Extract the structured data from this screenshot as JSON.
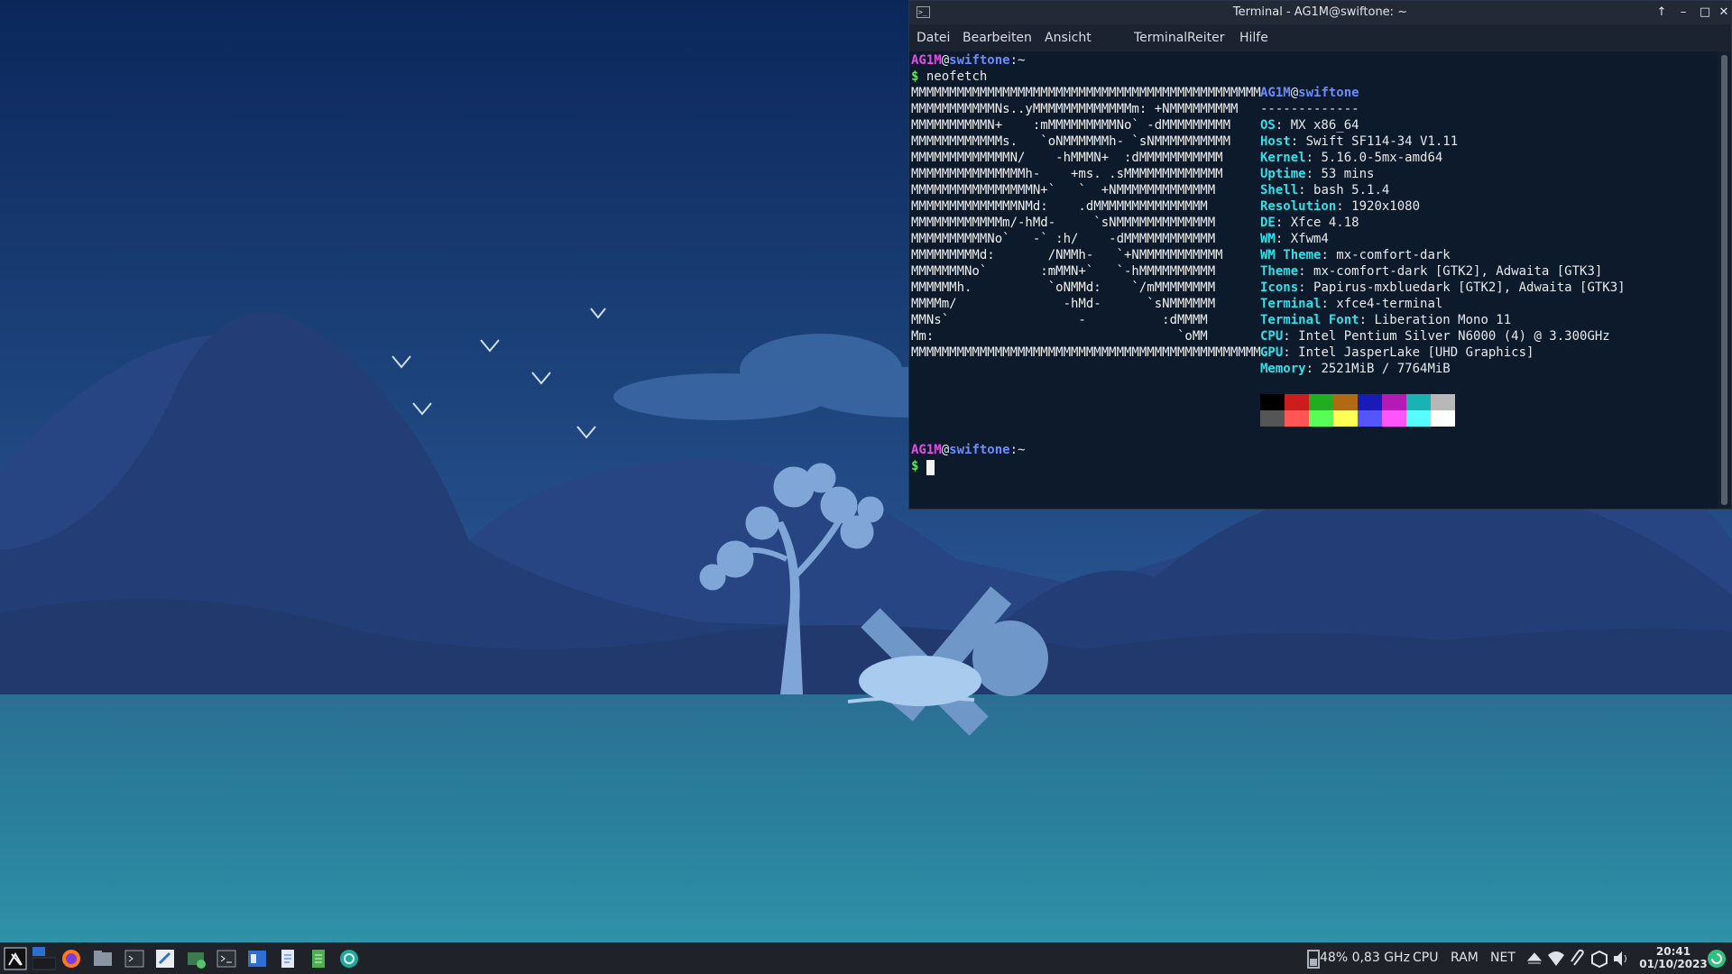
{
  "terminal": {
    "title": "Terminal - AG1M@swiftone: ~",
    "menu": [
      "Datei",
      "Bearbeiten",
      "Ansicht",
      "Terminal",
      "Reiter",
      "Hilfe"
    ],
    "prompt_user": "AG1M",
    "prompt_at": "@",
    "prompt_host": "swiftone",
    "prompt_path": ":~",
    "prompt_symbol": "$",
    "command": " neofetch",
    "ascii": [
      "MMMMMMMMMMMMMMMMMMMMMMMMMMMMMMMMMMMMMMMMMMMMMM",
      "MMMMMMMMMMMNs..yMMMMMMMMMMMMMm: +NMMMMMMMMM",
      "MMMMMMMMMMN+    :mMMMMMMMMMNo` -dMMMMMMMMM",
      "MMMMMMMMMMMMs.   `oNMMMMMMh- `sNMMMMMMMMMM",
      "MMMMMMMMMMMMMN/    -hMMMN+  :dMMMMMMMMMMM",
      "MMMMMMMMMMMMMMMh-    +ms. .sMMMMMMMMMMMMM",
      "MMMMMMMMMMMMMMMMN+`   `  +NMMMMMMMMMMMMM",
      "MMMMMMMMMMMMMMNMd:    .dMMMMMMMMMMMMMMM",
      "MMMMMMMMMMMMm/-hMd-     `sNMMMMMMMMMMMMM",
      "MMMMMMMMMMNo`   -` :h/    -dMMMMMMMMMMMM",
      "MMMMMMMMMd:       /NMMh-   `+NMMMMMMMMMMM",
      "MMMMMMMNo`       :mMMN+`   `-hMMMMMMMMMM",
      "MMMMMMh.          `oNMMd:    `/mMMMMMMMM",
      "MMMMm/              -hMd-      `sNMMMMMM",
      "MMNs`                 -          :dMMMM",
      "Mm:                                `oMM",
      "MMMMMMMMMMMMMMMMMMMMMMMMMMMMMMMMMMMMMMMMMMMMMM"
    ],
    "info_header_user": "AG1M",
    "info_header_at": "@",
    "info_header_host": "swiftone",
    "info_rule": "-------------",
    "info": [
      {
        "key": "OS",
        "value": "MX x86_64"
      },
      {
        "key": "Host",
        "value": "Swift SF114-34 V1.11"
      },
      {
        "key": "Kernel",
        "value": "5.16.0-5mx-amd64"
      },
      {
        "key": "Uptime",
        "value": "53 mins"
      },
      {
        "key": "Shell",
        "value": "bash 5.1.4"
      },
      {
        "key": "Resolution",
        "value": "1920x1080"
      },
      {
        "key": "DE",
        "value": "Xfce 4.18"
      },
      {
        "key": "WM",
        "value": "Xfwm4"
      },
      {
        "key": "WM Theme",
        "value": "mx-comfort-dark"
      },
      {
        "key": "Theme",
        "value": "mx-comfort-dark [GTK2], Adwaita [GTK3]"
      },
      {
        "key": "Icons",
        "value": "Papirus-mxbluedark [GTK2], Adwaita [GTK3]"
      },
      {
        "key": "Terminal",
        "value": "xfce4-terminal"
      },
      {
        "key": "Terminal Font",
        "value": "Liberation Mono 11"
      },
      {
        "key": "CPU",
        "value": "Intel Pentium Silver N6000 (4) @ 3.300GHz"
      },
      {
        "key": "GPU",
        "value": "Intel JasperLake [UHD Graphics]"
      },
      {
        "key": "Memory",
        "value": "2521MiB / 7764MiB"
      }
    ],
    "palette_top": [
      "#000000",
      "#cc1c1c",
      "#1fae1f",
      "#b06a12",
      "#1a1ab8",
      "#b51ab5",
      "#18b3b3",
      "#b8b8b8"
    ],
    "palette_bottom": [
      "#555555",
      "#ff5555",
      "#55ff55",
      "#ffff55",
      "#5555ff",
      "#ff55ff",
      "#55ffff",
      "#ffffff"
    ]
  },
  "taskbar": {
    "battery_text": "48% 0,83 GHz",
    "cpu_label": "CPU",
    "ram_label": "RAM",
    "net_label": "NET",
    "time": "20:41",
    "date": "01/10/2023"
  },
  "colors": {
    "sky_top": "#0c2a5c",
    "sky_bottom": "#2a5592",
    "mountain": "#253f77",
    "water": "#2c7a9a",
    "accent": "#33dfe8"
  }
}
